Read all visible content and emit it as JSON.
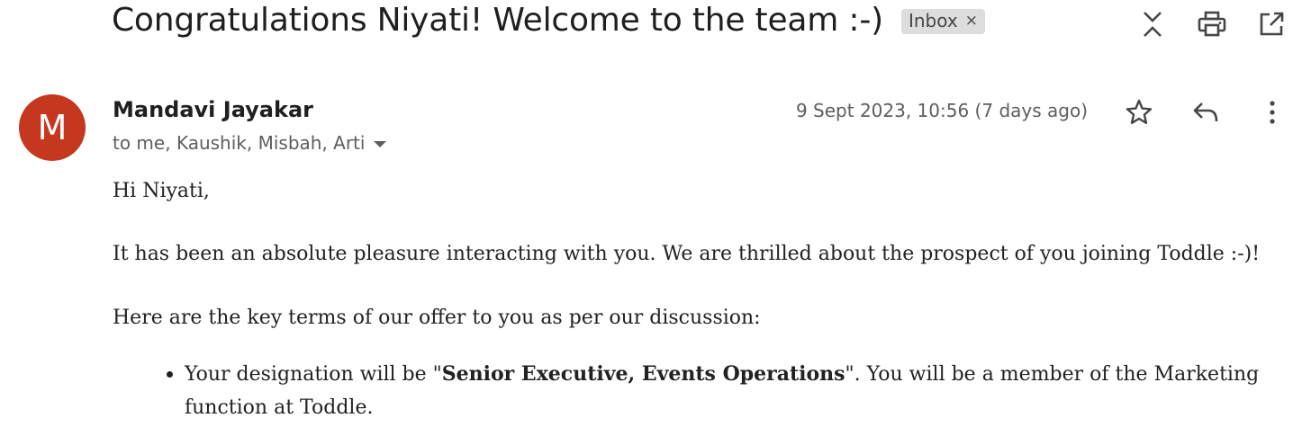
{
  "email": {
    "subject": "Congratulations Niyati! Welcome to the team :-)",
    "label": "Inbox",
    "label_close": "×",
    "sender_initial": "M",
    "sender_name": "Mandavi Jayakar",
    "recipients": "to me, Kaushik, Misbah, Arti",
    "date": "9 Sept 2023, 10:56 (7 days ago)",
    "body": {
      "greeting": "Hi Niyati,",
      "intro": "It has been an absolute pleasure interacting with you. We are thrilled about the prospect of you joining Toddle :-)!",
      "terms_intro": "Here are the key terms of our offer to you as per our discussion:",
      "bullets": [
        {
          "prefix": "Your designation will be \"",
          "bold": "Senior Executive, Events Operations",
          "suffix": "\". You will be a member of the Marketing",
          "continuation": "function at Toddle."
        }
      ]
    }
  },
  "icons": {
    "expand": "expand-collapse-icon",
    "print": "print-icon",
    "open_new_window": "open-in-new-window-icon",
    "star": "star-icon",
    "reply": "reply-icon",
    "more": "more-vert-icon"
  },
  "colors": {
    "avatar_bg": "#c5371f",
    "chip_bg": "#dddddd",
    "text_primary": "#1f1f1f",
    "text_secondary": "#5e5e5e"
  }
}
